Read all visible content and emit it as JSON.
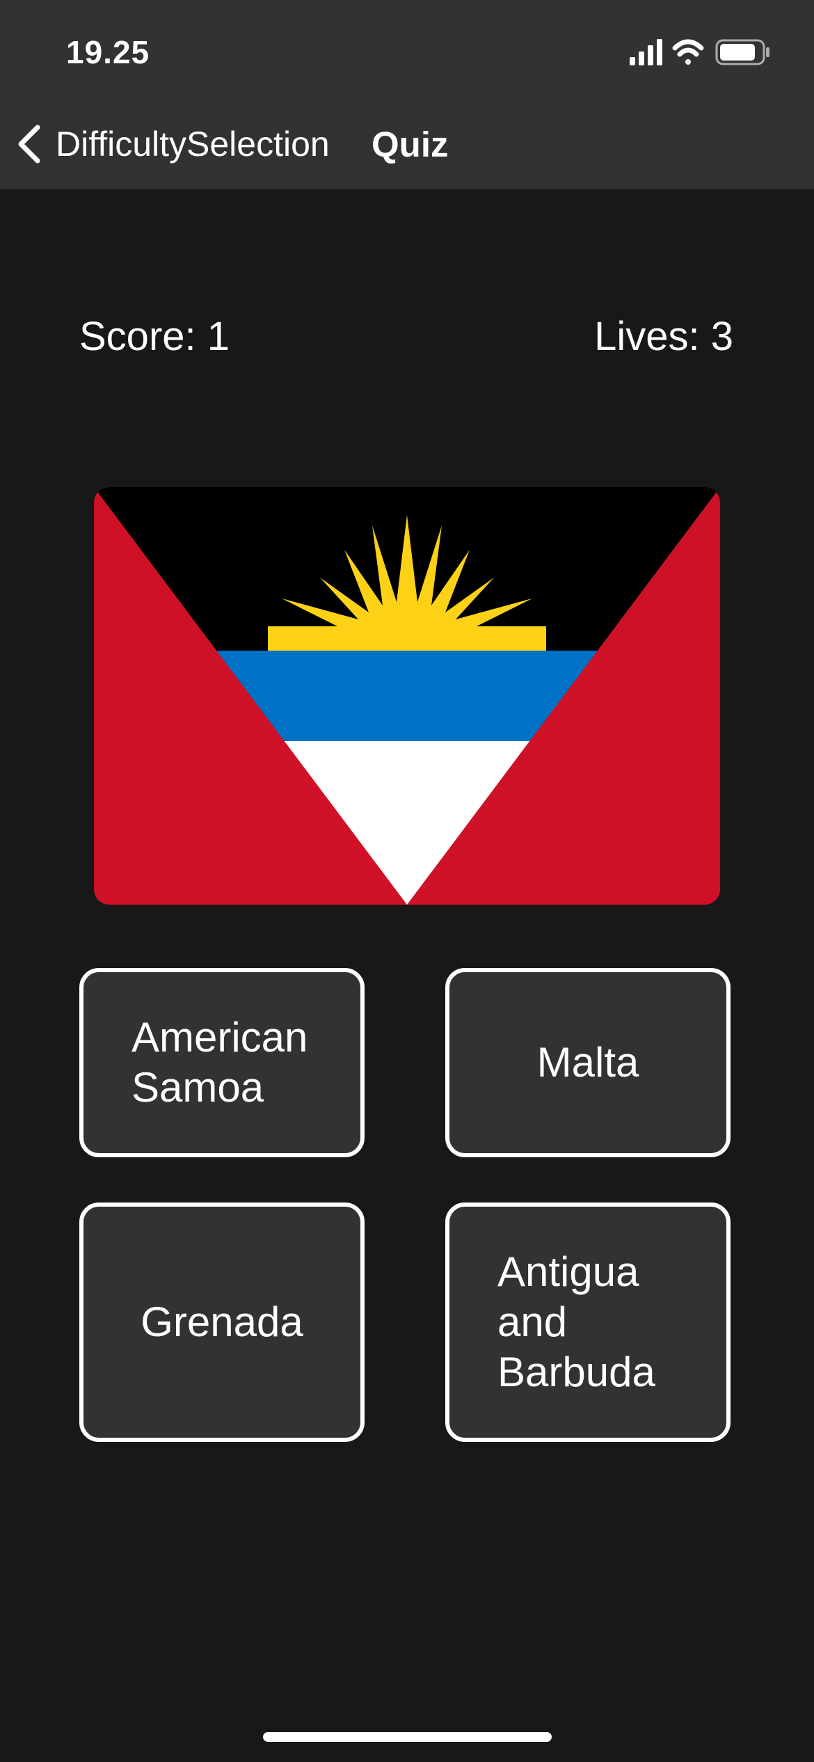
{
  "status_bar": {
    "time": "19.25",
    "icons": [
      "cellular-signal-icon",
      "wifi-icon",
      "battery-icon"
    ]
  },
  "nav": {
    "back_label": "DifficultySelection",
    "title": "Quiz"
  },
  "game": {
    "score_label": "Score: 1",
    "lives_label": "Lives: 3"
  },
  "flag": {
    "country_depicted": "Antigua and Barbuda",
    "colors": {
      "red": "#ce1126",
      "black": "#000000",
      "blue": "#0072c6",
      "white": "#ffffff",
      "sun": "#fcd116"
    }
  },
  "answers": [
    {
      "label": "American Samoa"
    },
    {
      "label": "Malta"
    },
    {
      "label": "Grenada"
    },
    {
      "label": "Antigua and Barbuda"
    }
  ],
  "theme": {
    "background": "#181818",
    "bar": "#323232",
    "button": "#323232",
    "border": "#ffffff"
  }
}
